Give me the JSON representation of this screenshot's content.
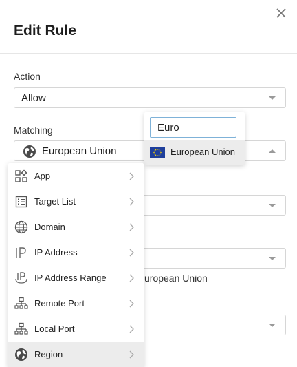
{
  "dialog": {
    "title": "Edit Rule",
    "close_icon": "close-icon"
  },
  "action": {
    "label": "Action",
    "value": "Allow"
  },
  "matching": {
    "label": "Matching",
    "value": "European Union",
    "icon": "globe-icon"
  },
  "background": {
    "partial_text": "uropean Union"
  },
  "search": {
    "value": "Euro",
    "result": "European Union",
    "result_icon": "eu-flag-icon"
  },
  "categories": [
    {
      "label": "App",
      "icon": "app-grid-icon"
    },
    {
      "label": "Target List",
      "icon": "list-icon"
    },
    {
      "label": "Domain",
      "icon": "globe-icon"
    },
    {
      "label": "IP Address",
      "icon": "ip-icon"
    },
    {
      "label": "IP Address Range",
      "icon": "ip-range-icon"
    },
    {
      "label": "Remote Port",
      "icon": "network-icon"
    },
    {
      "label": "Local Port",
      "icon": "network-icon"
    },
    {
      "label": "Region",
      "icon": "globe-filled-icon",
      "selected": true
    }
  ]
}
